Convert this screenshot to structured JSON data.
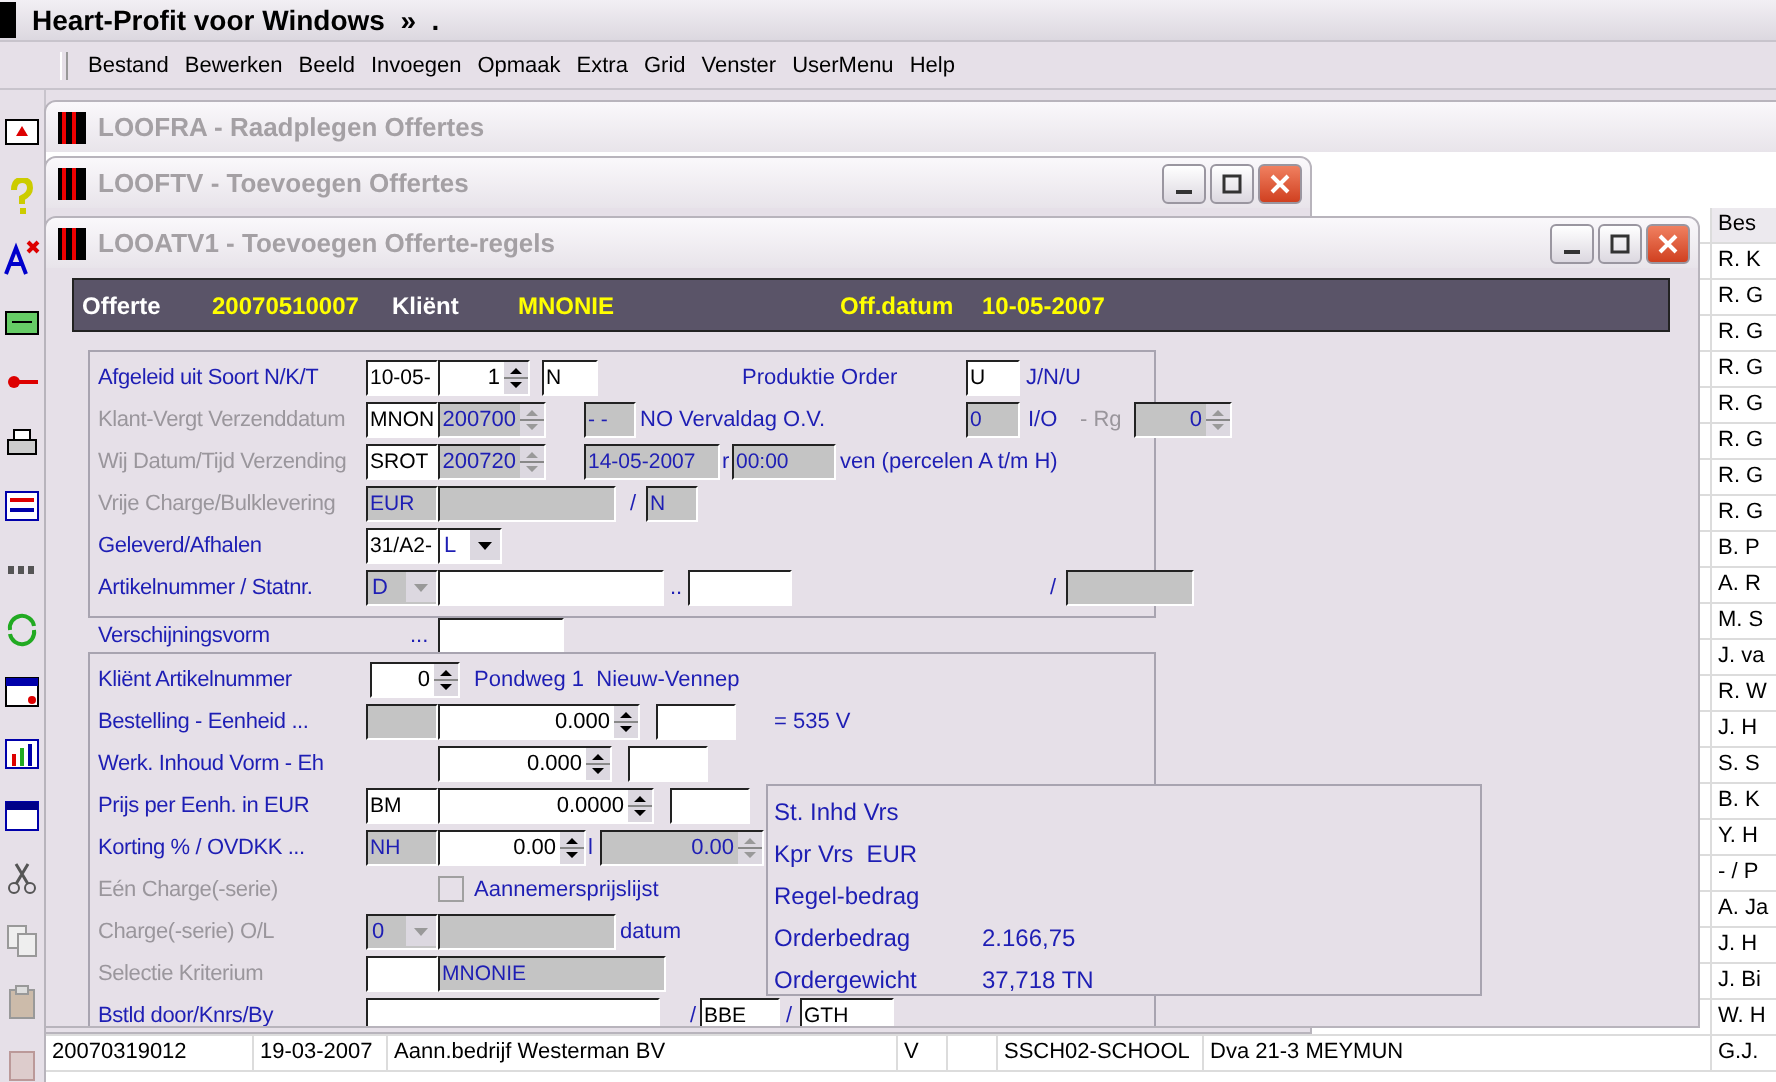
{
  "app_title": "Heart-Profit voor Windows  »  .",
  "menu": [
    "Bestand",
    "Bewerken",
    "Beeld",
    "Invoegen",
    "Opmaak",
    "Extra",
    "Grid",
    "Venster",
    "UserMenu",
    "Help"
  ],
  "windows": [
    {
      "title": "LOOFRA - Raadplegen Offertes"
    },
    {
      "title": "LOOFTV - Toevoegen Offertes"
    },
    {
      "title": "LOOATV1 - Toevoegen Offerte-regels"
    }
  ],
  "grid": {
    "header": "Bes",
    "rows": [
      {
        "last": "R. K"
      },
      {
        "last": "R. G"
      },
      {
        "last": "R. G"
      },
      {
        "last": "R. G"
      },
      {
        "last": "R. G"
      },
      {
        "last": "R. G"
      },
      {
        "last": "R. G"
      },
      {
        "last": "R. G"
      },
      {
        "last": "B. P"
      },
      {
        "last": "A. R"
      },
      {
        "last": "M. S"
      },
      {
        "last": "J. va"
      },
      {
        "last": "R. W"
      },
      {
        "last": "J. H"
      },
      {
        "last": "S. S"
      },
      {
        "last": "B. K"
      },
      {
        "last": "Y. H"
      },
      {
        "last": "- / P"
      },
      {
        "last": "A. Ja"
      },
      {
        "last": "J. H"
      },
      {
        "last": "J. Bi"
      },
      {
        "last": "W. H"
      },
      {
        "cells": [
          "20070319012",
          "19-03-2007",
          "Aann.bedrijf Westerman BV",
          "V",
          "SSCH02-SCHOOL",
          "Dva 21-3 MEYMUN"
        ],
        "last": "G.J."
      }
    ]
  },
  "header_bar": [
    {
      "kind": "label",
      "text": "Offerte"
    },
    {
      "kind": "value",
      "text": "20070510007"
    },
    {
      "kind": "label",
      "text": "Kliënt"
    },
    {
      "kind": "value",
      "text": "MNONIE"
    },
    {
      "kind": "value",
      "text": "Off.datum"
    },
    {
      "kind": "value",
      "text": "10-05-2007"
    }
  ],
  "upper_rows": [
    {
      "label": "Afgeleid uit Soort  N/K/T",
      "disabled": false,
      "items": [
        {
          "kind": "field",
          "value": "10-05-",
          "disabled": false
        },
        {
          "kind": "spin",
          "value": "1",
          "disabled": false
        },
        {
          "kind": "field",
          "value": "N",
          "disabled": false
        },
        {
          "kind": "text",
          "value": "Produktie Order",
          "disabled": false
        },
        {
          "kind": "field",
          "value": "U",
          "disabled": false
        },
        {
          "kind": "text",
          "value": "J/N/U",
          "disabled": false
        }
      ]
    },
    {
      "label": "Klant-Vergt Verzenddatum",
      "disabled": true,
      "items": [
        {
          "kind": "field",
          "value": "MNON",
          "disabled": false
        },
        {
          "kind": "spin",
          "value": "200700",
          "disabled": true
        },
        {
          "kind": "field",
          "value": "- -",
          "disabled": true
        },
        {
          "kind": "text",
          "value": "NO Vervaldag O.V.",
          "disabled": false
        },
        {
          "kind": "field",
          "value": "0",
          "disabled": true
        },
        {
          "kind": "text",
          "value": "I/O",
          "disabled": false
        },
        {
          "kind": "text",
          "value": "- Rg",
          "disabled": true
        },
        {
          "kind": "spin",
          "value": "0",
          "disabled": true
        }
      ]
    },
    {
      "label": "Wij Datum/Tijd Verzending",
      "disabled": true,
      "items": [
        {
          "kind": "field",
          "value": "SROT",
          "disabled": false
        },
        {
          "kind": "spin",
          "value": "200720",
          "disabled": true
        },
        {
          "kind": "field",
          "value": "14-05-2007",
          "disabled": true
        },
        {
          "kind": "text",
          "value": "r",
          "disabled": false
        },
        {
          "kind": "field",
          "value": "00:00",
          "disabled": true
        },
        {
          "kind": "text",
          "value": "ven (percelen A t/m H)",
          "disabled": false
        }
      ]
    },
    {
      "label": "Vrije Charge/Bulklevering",
      "disabled": true,
      "items": [
        {
          "kind": "field",
          "value": "EUR",
          "disabled": true
        },
        {
          "kind": "field",
          "disabled": true
        },
        {
          "kind": "text",
          "value": "/",
          "disabled": false
        },
        {
          "kind": "field",
          "value": "N",
          "disabled": true
        }
      ]
    },
    {
      "label": "Geleverd/Afhalen",
      "disabled": false,
      "items": [
        {
          "kind": "field",
          "value": "31/A2-",
          "disabled": false
        },
        {
          "kind": "select",
          "value": "L",
          "disabled": false
        }
      ]
    },
    {
      "label": "Artikelnummer / Statnr.",
      "disabled": false,
      "items": [
        {
          "kind": "select",
          "value": "D",
          "disabled": true
        },
        {
          "kind": "field",
          "disabled": false
        },
        {
          "kind": "text",
          "value": "..",
          "disabled": false
        },
        {
          "kind": "field",
          "disabled": false
        },
        {
          "kind": "text",
          "value": "/",
          "disabled": false
        },
        {
          "kind": "field",
          "disabled": true
        }
      ]
    }
  ],
  "middle_row": {
    "label": "Verschijningsvorm",
    "disabled": false,
    "items": [
      {
        "kind": "text",
        "value": "...",
        "disabled": false
      },
      {
        "kind": "field",
        "disabled": false
      }
    ]
  },
  "lower_rows": [
    {
      "label": "Kliënt Artikelnummer",
      "disabled": false,
      "items": [
        {
          "kind": "spin",
          "value": "0",
          "disabled": false
        },
        {
          "kind": "text",
          "value": "Pondweg 1  Nieuw-Vennep",
          "disabled": false
        }
      ]
    },
    {
      "label": "Bestelling - Eenheid ...",
      "disabled": false,
      "items": [
        {
          "kind": "field",
          "disabled": true
        },
        {
          "kind": "spin",
          "value": "0.000",
          "disabled": false
        },
        {
          "kind": "field",
          "disabled": false
        },
        {
          "kind": "text",
          "value": "= 535 V",
          "disabled": false
        }
      ]
    },
    {
      "label": "Werk. Inhoud Vorm - Eh",
      "disabled": false,
      "items": [
        {
          "kind": "spin",
          "value": "0.000",
          "disabled": false
        },
        {
          "kind": "field",
          "disabled": false
        }
      ]
    },
    {
      "label": "Prijs per Eenh. in EUR",
      "disabled": false,
      "items": [
        {
          "kind": "field",
          "value": "BM",
          "disabled": false
        },
        {
          "kind": "spin",
          "value": "0.0000",
          "disabled": false
        },
        {
          "kind": "field",
          "disabled": false
        }
      ]
    },
    {
      "label": "Korting % / OVDKK ...",
      "disabled": false,
      "items": [
        {
          "kind": "field",
          "value": "NH",
          "disabled": true
        },
        {
          "kind": "spin",
          "value": "0.00",
          "disabled": false
        },
        {
          "kind": "text",
          "value": "l",
          "disabled": false
        },
        {
          "kind": "spin",
          "value": "0.00",
          "disabled": true
        }
      ]
    },
    {
      "label": "Eén Charge(-serie)",
      "disabled": true,
      "items": [
        {
          "kind": "check",
          "checked": false
        },
        {
          "kind": "text",
          "value": "Aannemersprijslijst",
          "disabled": false
        }
      ]
    },
    {
      "label": "Charge(-serie)     O/L",
      "disabled": true,
      "items": [
        {
          "kind": "select",
          "value": "0",
          "disabled": true
        },
        {
          "kind": "field",
          "disabled": true
        },
        {
          "kind": "text",
          "value": "datum",
          "disabled": false
        }
      ]
    },
    {
      "label": "Selectie Kriterium",
      "disabled": true,
      "items": [
        {
          "kind": "field",
          "disabled": false
        },
        {
          "kind": "field",
          "value": "MNONIE",
          "disabled": true
        }
      ]
    },
    {
      "label": "Bstld door/Knrs/By",
      "disabled": false,
      "items": [
        {
          "kind": "field",
          "disabled": false
        },
        {
          "kind": "text",
          "value": "/",
          "disabled": false
        },
        {
          "kind": "field",
          "value": "BBE",
          "disabled": false
        },
        {
          "kind": "text",
          "value": "/",
          "disabled": false
        },
        {
          "kind": "field",
          "value": "GTH",
          "disabled": false
        }
      ]
    }
  ],
  "summary": [
    {
      "label": "St. Inhd Vrs"
    },
    {
      "label": "Kpr Vrs  EUR"
    },
    {
      "label": "Regel-bedrag"
    },
    {
      "label": "Orderbedrag",
      "value": "2.166,75"
    },
    {
      "label": "Ordergewicht",
      "value": "37,718 TN"
    }
  ]
}
